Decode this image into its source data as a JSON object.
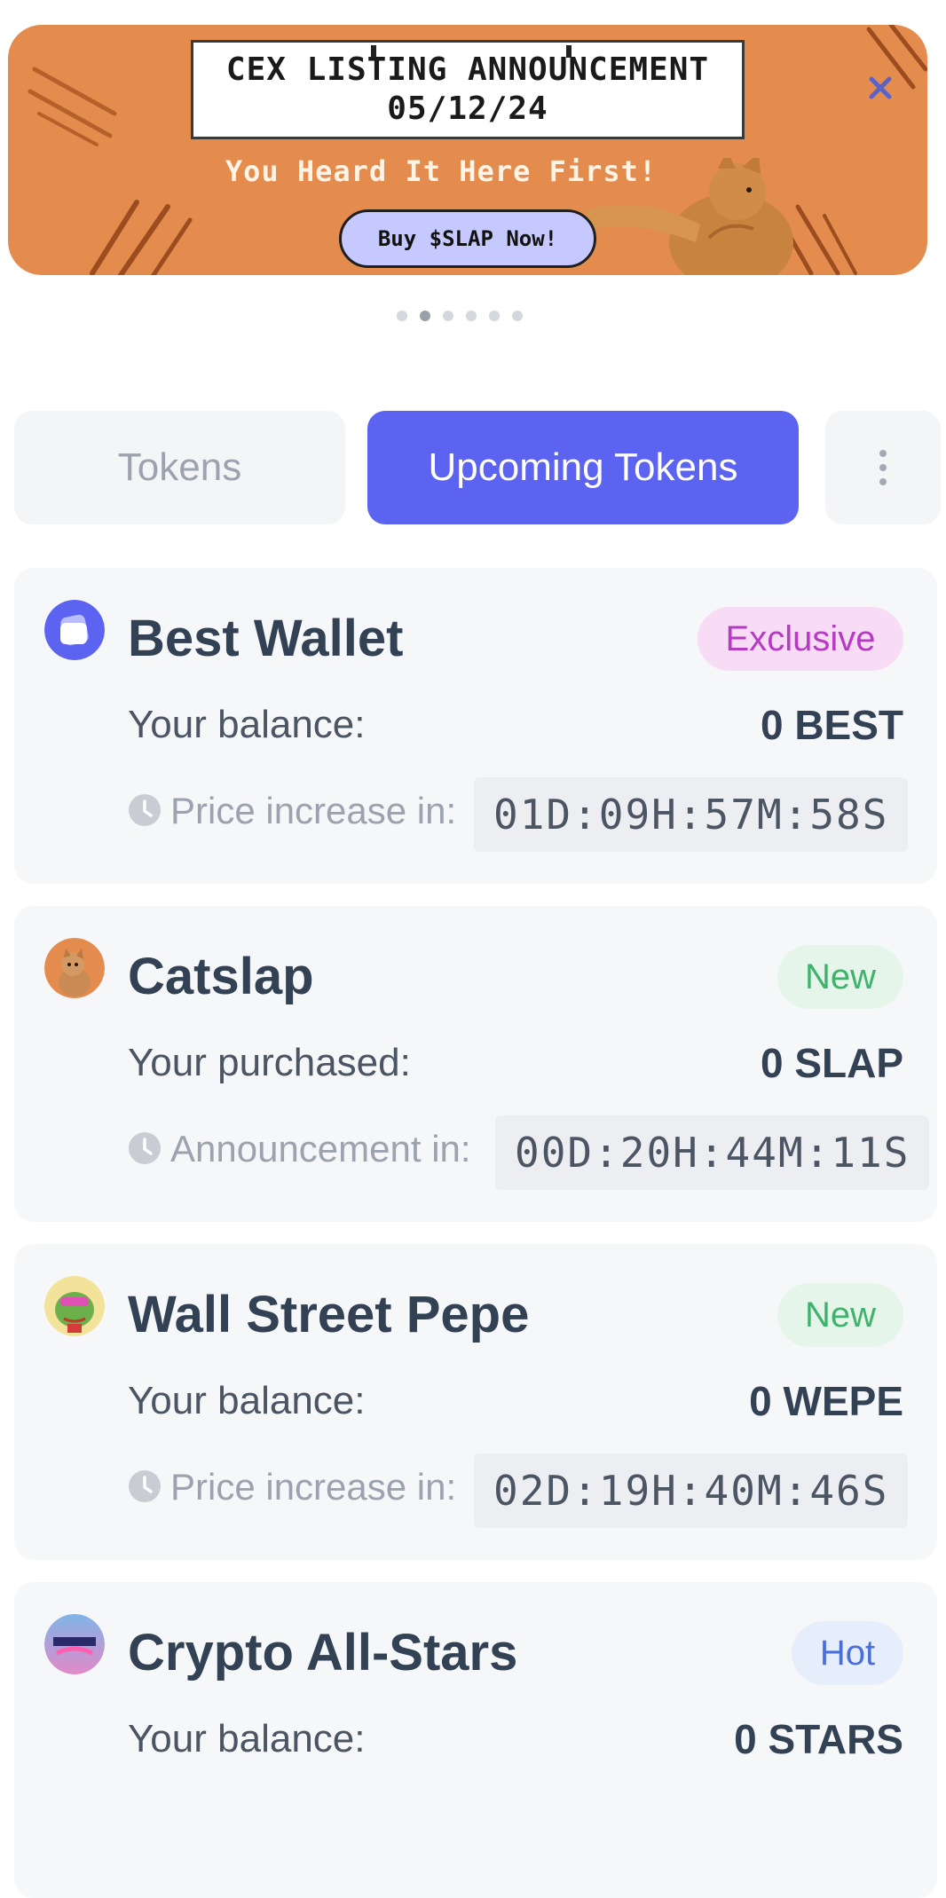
{
  "banner": {
    "sign_line1": "CEX LISTING ANNOUNCEMENT",
    "sign_line2": "05/12/24",
    "tagline": "You Heard It Here First!",
    "button_label": "Buy $SLAP Now!",
    "close_icon": "close-icon",
    "background_color": "#e38c4d"
  },
  "carousel": {
    "dot_count": 6,
    "active_index": 1
  },
  "tabs": [
    {
      "label": "Tokens",
      "active": false
    },
    {
      "label": "Upcoming Tokens",
      "active": true
    }
  ],
  "more_icon": "kebab-menu-icon",
  "accent_color": "#5b63f0",
  "tokens": [
    {
      "name": "Best Wallet",
      "badge": "Exclusive",
      "row_label": "Your balance:",
      "row_value": "0 BEST",
      "timer_label": "Price increase in:",
      "timer": "01D:09H:57M:58S",
      "icon": "best-wallet-logo-icon"
    },
    {
      "name": "Catslap",
      "badge": "New",
      "row_label": "Your purchased:",
      "row_value": "0 SLAP",
      "timer_label": "Announcement in:",
      "timer": "00D:20H:44M:11S",
      "icon": "catslap-logo-icon"
    },
    {
      "name": "Wall Street Pepe",
      "badge": "New",
      "row_label": "Your balance:",
      "row_value": "0 WEPE",
      "timer_label": "Price increase in:",
      "timer": "02D:19H:40M:46S",
      "icon": "wall-street-pepe-logo-icon"
    },
    {
      "name": "Crypto All-Stars",
      "badge": "Hot",
      "row_label": "Your balance:",
      "row_value": "0 STARS",
      "icon": "crypto-all-stars-logo-icon"
    }
  ]
}
